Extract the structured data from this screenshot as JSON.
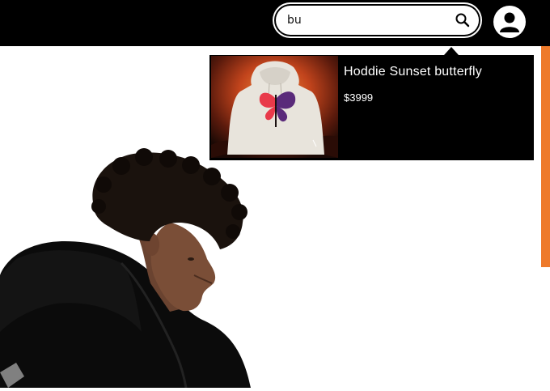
{
  "search": {
    "value": "bu",
    "placeholder": ""
  },
  "results": [
    {
      "name": "Hoddie Sunset butterfly",
      "price": "$3999"
    }
  ],
  "colors": {
    "topbar": "#000000",
    "accent": "#ee7a2a",
    "dropdown": "#000000"
  },
  "icons": {
    "search": "search-icon",
    "account": "user-icon"
  }
}
